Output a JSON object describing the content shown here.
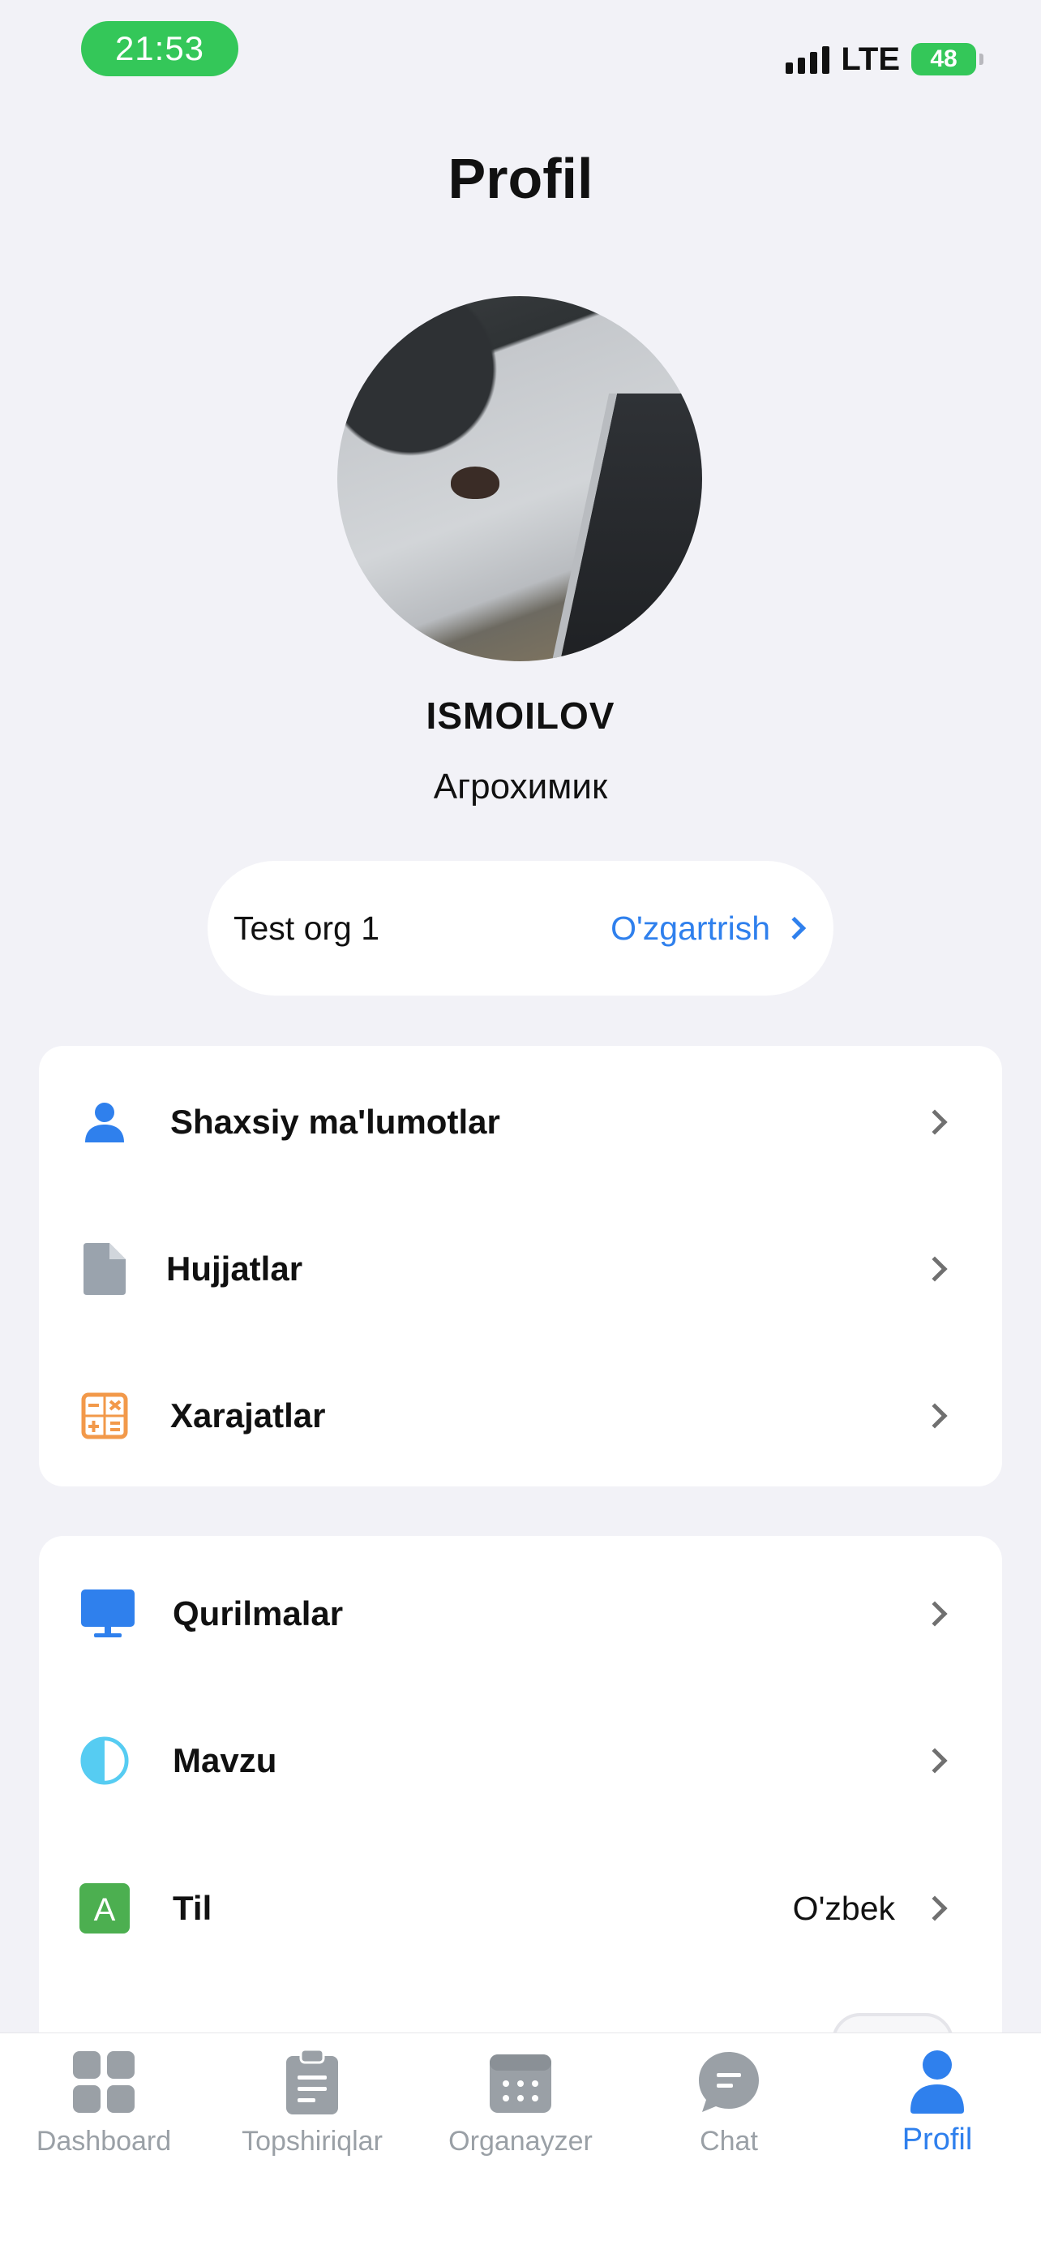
{
  "status_bar": {
    "time": "21:53",
    "network": "LTE",
    "battery": "48"
  },
  "header": {
    "title": "Profil"
  },
  "profile": {
    "name": "ISMOILOV",
    "role": "Агрохимик"
  },
  "organization": {
    "name": "Test org 1",
    "change_label": "O'zgartrish"
  },
  "menu_group_1": [
    {
      "label": "Shaxsiy ma'lumotlar",
      "icon": "person-icon"
    },
    {
      "label": "Hujjatlar",
      "icon": "document-icon"
    },
    {
      "label": "Xarajatlar",
      "icon": "calculator-icon"
    }
  ],
  "menu_group_2": [
    {
      "label": "Qurilmalar",
      "icon": "monitor-icon"
    },
    {
      "label": "Mavzu",
      "icon": "theme-icon"
    },
    {
      "label": "Til",
      "icon": "language-icon",
      "value": "O'zbek"
    }
  ],
  "tabs": [
    {
      "label": "Dashboard",
      "icon": "grid-icon",
      "active": false
    },
    {
      "label": "Topshiriqlar",
      "icon": "clipboard-icon",
      "active": false
    },
    {
      "label": "Organayzer",
      "icon": "calendar-icon",
      "active": false
    },
    {
      "label": "Chat",
      "icon": "chat-icon",
      "active": false
    },
    {
      "label": "Profil",
      "icon": "profile-icon",
      "active": true
    }
  ],
  "colors": {
    "accent": "#2f80ed",
    "status_green": "#34c759",
    "background": "#f2f2f7",
    "inactive_tab": "#9aa0a6"
  }
}
